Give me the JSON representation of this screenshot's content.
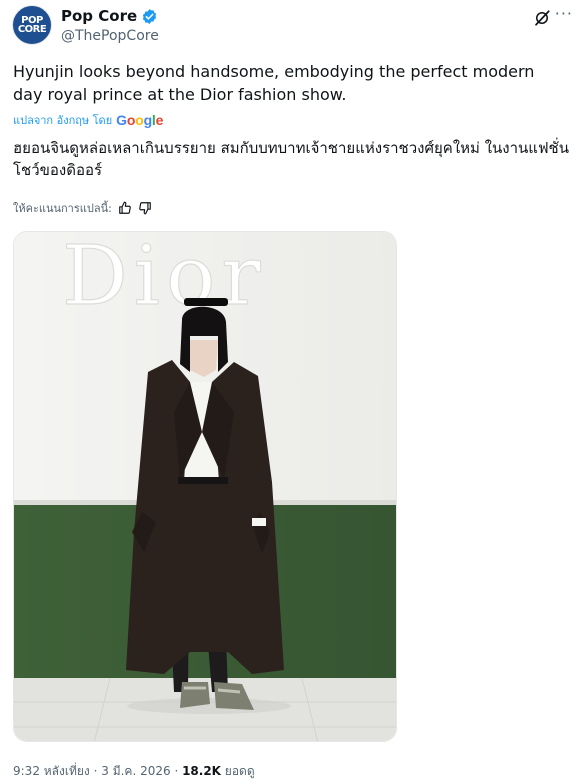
{
  "author": {
    "name": "Pop Core",
    "handle": "@ThePopCore",
    "avatar_line1": "POP",
    "avatar_line2": "CORE"
  },
  "post": {
    "text": "Hyunjin looks beyond handsome, embodying the perfect modern day royal prince at the Dior fashion show.",
    "translated_from_label": "แปลจาก อังกฤษ โดย",
    "translator_brand": "Google",
    "translation": "ฮยอนจินดูหล่อเหลาเกินบรรยาย สมกับบทบาทเจ้าชายแห่งราชวงศ์ยุคใหม่ ในงานแฟชั่นโชว์ของดิออร์",
    "rate_label": "ให้คะแนนการแปลนี้:",
    "image_wall_text": "Dior"
  },
  "meta": {
    "time": "9:32 หลังเที่ยง",
    "sep1": " · ",
    "date": "3 มี.ค. 2026",
    "sep2": " · ",
    "views": "18.2K",
    "views_label": " ยอดดู"
  },
  "colors": {
    "accent": "#1d9bf0",
    "secondary_text": "#536471",
    "wall_green": "#3d5e36",
    "coat": "#2b211d"
  },
  "icons": [
    "verified-badge-icon",
    "grok-icon",
    "more-icon",
    "thumbs-up-icon",
    "thumbs-down-icon"
  ]
}
